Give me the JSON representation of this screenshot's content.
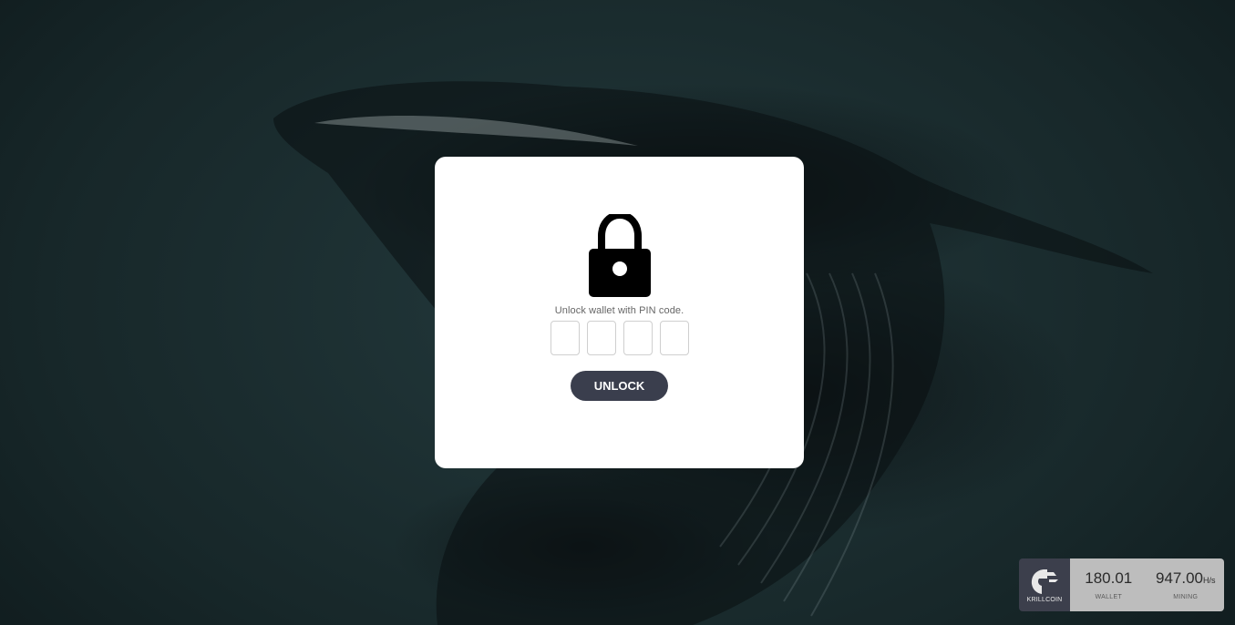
{
  "background": {
    "description_icon": "whale-photo"
  },
  "modal": {
    "icon": "lock-icon",
    "prompt": "Unlock wallet with PIN code.",
    "pins": [
      "",
      "",
      "",
      ""
    ],
    "unlock_label": "UNLOCK"
  },
  "status_widget": {
    "logo_icon": "krillcoin-logo-icon",
    "brand": "KRILLCOIN",
    "wallet_value": "180.01",
    "wallet_label": "WALLET",
    "mining_value": "947.00",
    "mining_unit": "H/s",
    "mining_label": "MINING"
  },
  "colors": {
    "button": "#3a3e4d",
    "widget_logo_bg": "#3c3f4c",
    "widget_bg": "#bdbdbd"
  }
}
